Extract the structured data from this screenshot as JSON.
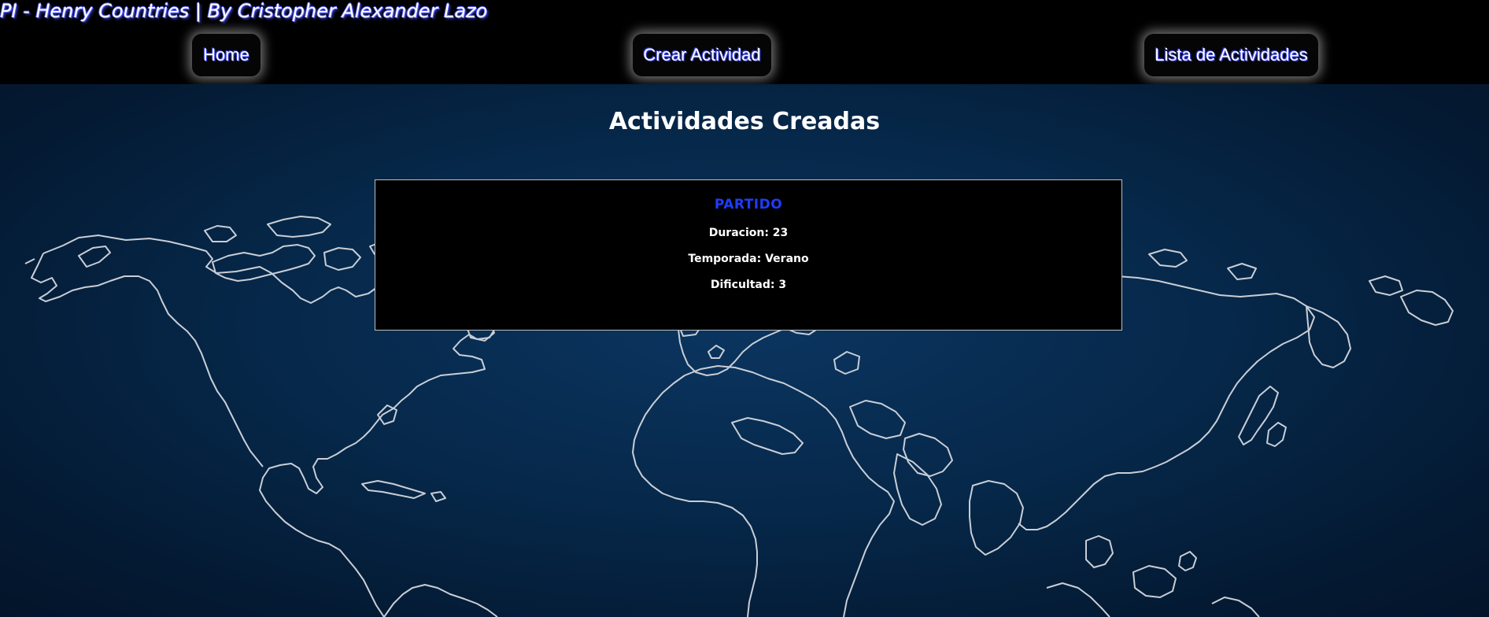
{
  "header": {
    "brand": "PI - Henry Countries | By Cristopher Alexander Lazo",
    "nav": [
      {
        "label": "Home"
      },
      {
        "label": "Crear Actividad"
      },
      {
        "label": "Lista de Actividades"
      }
    ]
  },
  "main": {
    "title": "Actividades Creadas",
    "activities": [
      {
        "name": "PARTIDO",
        "duration": "Duracion: 23",
        "season": "Temporada: Verano",
        "difficulty": "Dificultad: 3"
      }
    ]
  },
  "colors": {
    "accent": "#1f3cff",
    "background_top": "#000000",
    "background_map": "#06284a"
  }
}
